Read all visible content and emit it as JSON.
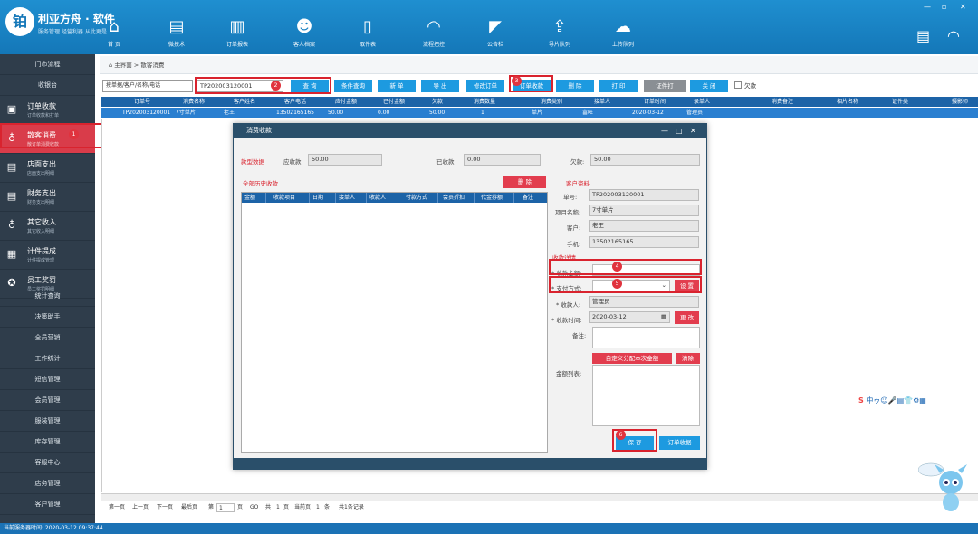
{
  "app": {
    "logo_char": "铂",
    "name": "利亚方舟 · 软件",
    "slogan": "服务管理 经营利器 从此更是"
  },
  "nav": [
    {
      "label": "首 页",
      "icon": "home-icon"
    },
    {
      "label": "微技术",
      "icon": "book-icon"
    },
    {
      "label": "订单报表",
      "icon": "chart-icon"
    },
    {
      "label": "客人档案",
      "icon": "people-icon"
    },
    {
      "label": "取件表",
      "icon": "clipboard-icon"
    },
    {
      "label": "流程把控",
      "icon": "signal-icon"
    },
    {
      "label": "公告栏",
      "icon": "megaphone-icon"
    },
    {
      "label": "导片队列",
      "icon": "export-icon"
    },
    {
      "label": "上传队列",
      "icon": "upload-icon"
    }
  ],
  "window": {
    "minimize": "—",
    "restore": "▫",
    "close": "✕"
  },
  "sidebar": {
    "top": [
      {
        "label": "门市流程"
      },
      {
        "label": "收银台"
      }
    ],
    "items": [
      {
        "title": "订单收款",
        "sub": "订单收款和打单",
        "icon": "cashier-icon"
      },
      {
        "title": "散客消费",
        "sub": "散订单消费收款",
        "icon": "money-bag-icon",
        "active": true
      },
      {
        "title": "店面支出",
        "sub": "店面支出明细",
        "icon": "wallet-icon"
      },
      {
        "title": "财务支出",
        "sub": "财务支出明细",
        "icon": "finance-icon"
      },
      {
        "title": "其它收入",
        "sub": "其它收入明细",
        "icon": "income-icon"
      },
      {
        "title": "计件提成",
        "sub": "计件提成管理",
        "icon": "calculator-icon"
      },
      {
        "title": "员工奖罚",
        "sub": "员工奖罚明细",
        "icon": "medal-icon"
      }
    ],
    "bottom": [
      {
        "label": "统计查询"
      },
      {
        "label": "决策助手"
      },
      {
        "label": "全员营销"
      },
      {
        "label": "工作统计"
      },
      {
        "label": "短信管理"
      },
      {
        "label": "会员管理"
      },
      {
        "label": "服装管理"
      },
      {
        "label": "库存管理"
      },
      {
        "label": "客服中心"
      },
      {
        "label": "店务管理"
      },
      {
        "label": "客户管理"
      }
    ]
  },
  "breadcrumb": {
    "home": "主界面",
    "sep": ">",
    "current": "散客消费"
  },
  "toolbar": {
    "filter_select": "按单据/客户/名称/电话",
    "search_value": "TP202003120001",
    "query": "查 询",
    "cond_query": "条件查询",
    "add": "新 单",
    "export": "导 出",
    "edit_order": "修改订单",
    "receive": "订单收款",
    "delete": "删 除",
    "print": "打 印",
    "print_preview": "证件打",
    "close": "关 闭",
    "owe_label": "欠款"
  },
  "grid": {
    "headers": [
      "订单号",
      "消费名称",
      "客户姓名",
      "客户电话",
      "应付金额",
      "已付金额",
      "欠款",
      "消费数量",
      "消费类别",
      "接单人",
      "订单时间",
      "录单人",
      "消费备注",
      "相片名称",
      "证件类",
      "摄影师"
    ],
    "row": [
      "TP202003120001",
      "7寸单片",
      "老王",
      "13502165165",
      "50.00",
      "0.00",
      "50.00",
      "1",
      "单片",
      "富旺",
      "2020-03-12",
      "管理员",
      "",
      "",
      "",
      ""
    ]
  },
  "pager": {
    "first": "第一页",
    "prev": "上一页",
    "next": "下一页",
    "last": "最后页",
    "page_label": "第",
    "page": "1",
    "page_unit": "页",
    "go": "GO",
    "total_label": "共",
    "total_pages": "1",
    "total_unit": "页",
    "current_label": "当前页",
    "current_count": "1",
    "current_unit": "条",
    "all_label": "共1条记录"
  },
  "status": {
    "text": "当前服务器时间: 2020-03-12 09:37:44"
  },
  "dialog": {
    "title": "消费收款",
    "minimize": "—",
    "maximize": "□",
    "close": "✕",
    "summary_label": "款型数据",
    "receivable_label": "应收款:",
    "receivable": "50.00",
    "paid_label": "已收款:",
    "paid": "0.00",
    "owe_label": "欠款:",
    "owe": "50.00",
    "history_label": "全部历史收款",
    "delete_btn": "删 除",
    "table_headers": [
      "金额",
      "收款项目",
      "日期",
      "接单人",
      "收款人",
      "付款方式",
      "会员折扣",
      "代金券额",
      "备注"
    ],
    "customer_label": "客户资料",
    "order_no_label": "单号:",
    "order_no": "TP202003120001",
    "item_label": "项目名称:",
    "item": "7寸单片",
    "customer_name_label": "客户:",
    "customer_name": "老王",
    "phone_label": "手机:",
    "phone": "13502165165",
    "collect_label": "收款详情",
    "amount_label": "* 收款金额:",
    "amount": "",
    "pay_method_label": "* 支付方式:",
    "pay_method": "",
    "setup_btn": "设 置",
    "collector_label": "* 收款人:",
    "collector": "管理员",
    "time_label": "* 收款时间:",
    "time": "2020-03-12",
    "change_btn": "更 改",
    "remark_label": "备注:",
    "remark": "",
    "custom_btn": "自定义分配本次金额",
    "clear_btn": "清除",
    "assign_label": "金额列表:",
    "save_btn": "保 存",
    "receipt_btn": "订单收据"
  },
  "markers": [
    "1",
    "2",
    "3",
    "4",
    "5",
    "6"
  ],
  "ime": "中ゥ☺🎤▤👕⚙▦"
}
